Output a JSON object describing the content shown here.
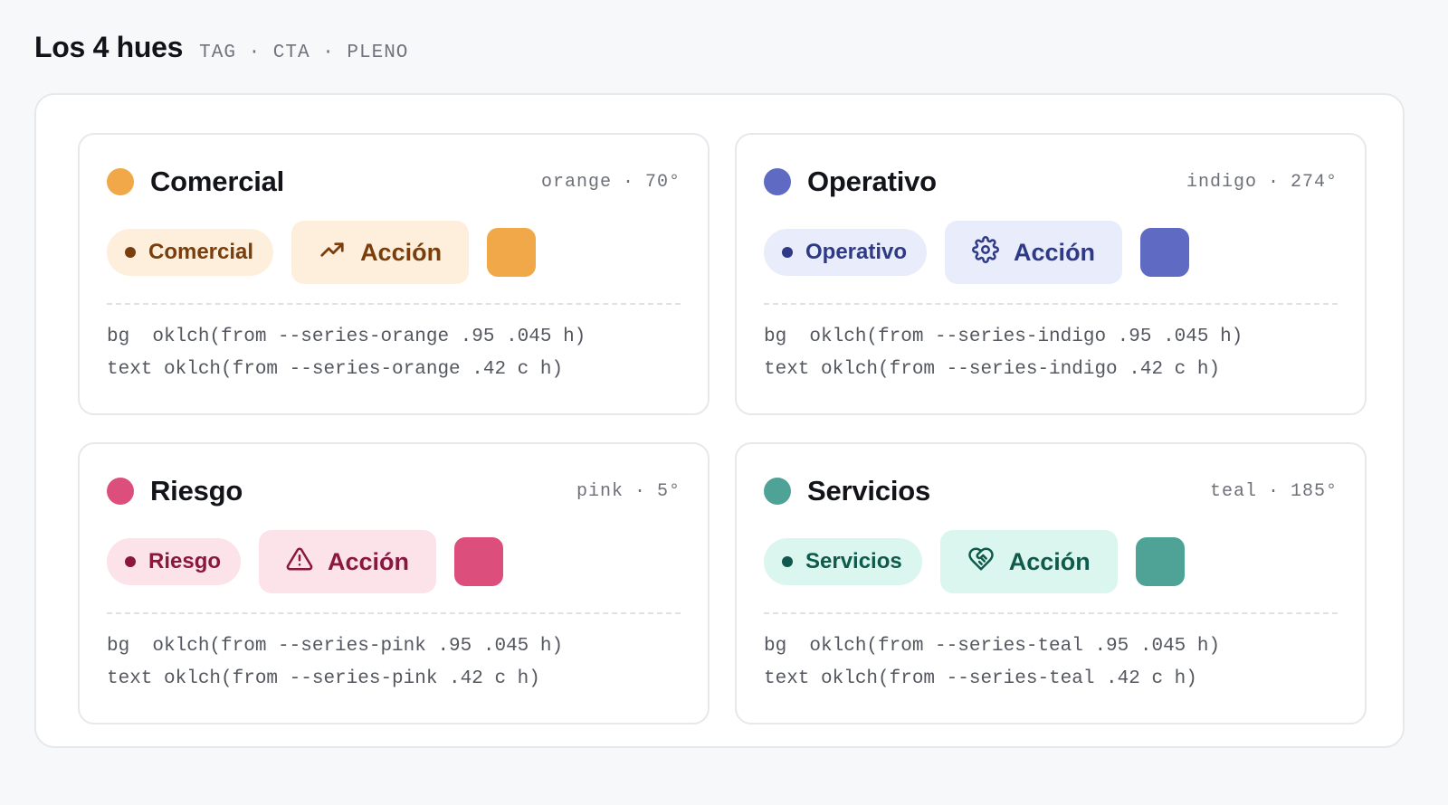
{
  "header": {
    "title": "Los 4 hues",
    "subtitle": "TAG · CTA · PLENO"
  },
  "cards": [
    {
      "name": "Comercial",
      "hue_name": "orange",
      "hue_deg": "70°",
      "tag_label": "Comercial",
      "cta_label": "Acción",
      "cta_icon": "trending-up-icon",
      "bg_line": "bg  oklch(from --series-orange .95 .045 h)",
      "text_line": "text oklch(from --series-orange .42 c h)",
      "colors": {
        "solid": "#f0a848",
        "bg": "#fdefdc",
        "text": "#7a3d0c"
      }
    },
    {
      "name": "Operativo",
      "hue_name": "indigo",
      "hue_deg": "274°",
      "tag_label": "Operativo",
      "cta_label": "Acción",
      "cta_icon": "gear-icon",
      "bg_line": "bg  oklch(from --series-indigo .95 .045 h)",
      "text_line": "text oklch(from --series-indigo .42 c h)",
      "colors": {
        "solid": "#5f6bc2",
        "bg": "#e8ecfb",
        "text": "#2e3a86"
      }
    },
    {
      "name": "Riesgo",
      "hue_name": "pink",
      "hue_deg": "5°",
      "tag_label": "Riesgo",
      "cta_label": "Acción",
      "cta_icon": "warning-triangle-icon",
      "bg_line": "bg  oklch(from --series-pink .95 .045 h)",
      "text_line": "text oklch(from --series-pink .42 c h)",
      "colors": {
        "solid": "#dc4f7c",
        "bg": "#fce3e9",
        "text": "#8a1740"
      }
    },
    {
      "name": "Servicios",
      "hue_name": "teal",
      "hue_deg": "185°",
      "tag_label": "Servicios",
      "cta_label": "Acción",
      "cta_icon": "heart-handshake-icon",
      "bg_line": "bg  oklch(from --series-teal .95 .045 h)",
      "text_line": "text oklch(from --series-teal .42 c h)",
      "colors": {
        "solid": "#4fa396",
        "bg": "#daf6ef",
        "text": "#0f5a4c"
      }
    }
  ]
}
